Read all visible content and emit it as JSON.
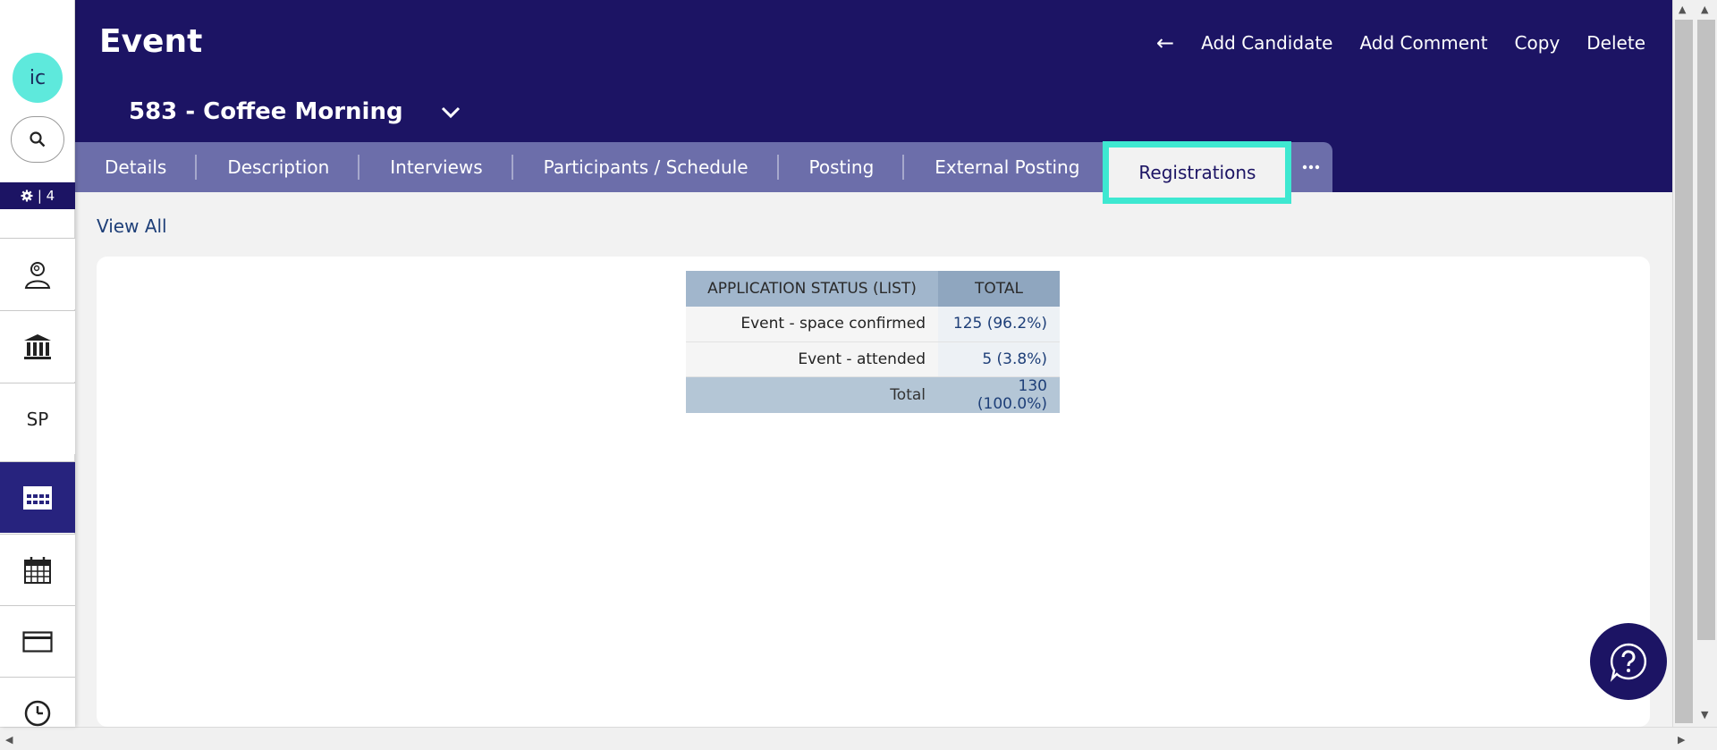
{
  "sidebar": {
    "avatar_initials": "ic",
    "counter": "| 4",
    "items": [
      {
        "icon": "person-search-icon"
      },
      {
        "icon": "bank-icon"
      },
      {
        "label": "SP"
      },
      {
        "icon": "calendar-grid-icon",
        "active": true
      },
      {
        "icon": "calendar-icon"
      },
      {
        "icon": "envelope-icon"
      },
      {
        "icon": "clock-icon"
      }
    ]
  },
  "header": {
    "title": "Event",
    "actions": {
      "back": "←",
      "add_candidate": "Add Candidate",
      "add_comment": "Add Comment",
      "copy": "Copy",
      "delete": "Delete"
    },
    "record_title": "583 - Coffee Morning"
  },
  "tabs": [
    {
      "label": "Details"
    },
    {
      "label": "Description"
    },
    {
      "label": "Interviews"
    },
    {
      "label": "Participants / Schedule"
    },
    {
      "label": "Posting"
    },
    {
      "label": "External Posting"
    },
    {
      "label": "Registrations",
      "active": true
    }
  ],
  "content": {
    "view_all": "View All",
    "table": {
      "headers": [
        "APPLICATION STATUS (LIST)",
        "TOTAL"
      ],
      "rows": [
        {
          "label": "Event - space confirmed",
          "value": "125 (96.2%)"
        },
        {
          "label": "Event - attended",
          "value": "5 (3.8%)"
        }
      ],
      "total": {
        "label": "Total",
        "value": "130 (100.0%)"
      }
    }
  },
  "colors": {
    "header_bg": "#1c1464",
    "tab_bar": "#6c6eaa",
    "active_tab_border": "#3ee8d1",
    "avatar": "#5ee9dc",
    "link": "#1e3f78"
  }
}
